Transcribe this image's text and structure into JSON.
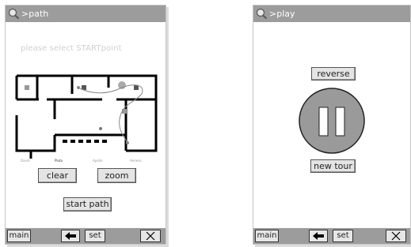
{
  "screens": {
    "path": {
      "title": ">path",
      "prompt": "please select STARTpoint",
      "floor_labels": [
        "David",
        "Pluto",
        "Apollo",
        "Aeneas"
      ],
      "buttons": {
        "clear": "clear",
        "zoom": "zoom",
        "start_path": "start path"
      },
      "nav": {
        "main": "main",
        "set": "set"
      }
    },
    "play": {
      "title": ">play",
      "buttons": {
        "reverse": "reverse",
        "new_tour": "new tour"
      },
      "nav": {
        "main": "main",
        "set": "set"
      }
    }
  },
  "icons": {
    "title_icon": "magnifier-icon",
    "back": "left-arrow-icon",
    "close": "close-icon",
    "pause": "pause-icon",
    "museum": "floor-plan-map"
  },
  "colors": {
    "titlebar": "#9c9c9c",
    "button_bg": "#e4e4e4",
    "pause_circle": "#9a9a9a",
    "path_line": "#888888"
  }
}
